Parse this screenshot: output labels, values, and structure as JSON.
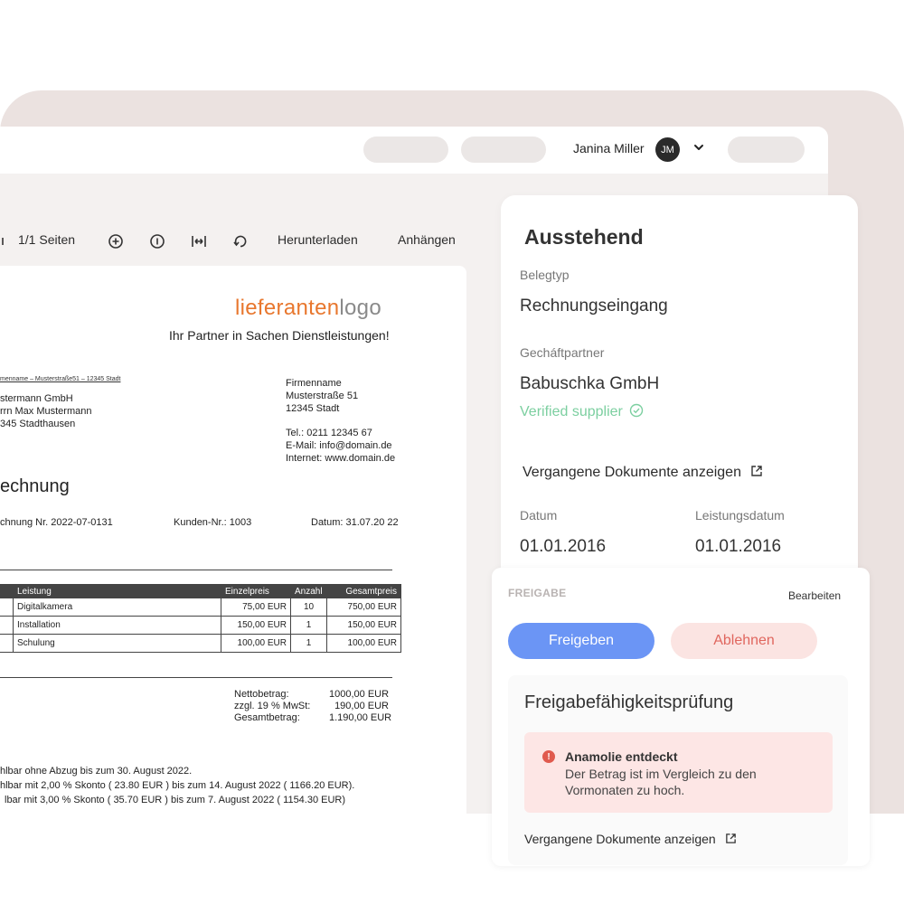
{
  "header": {
    "user_name": "Janina Miller",
    "user_initials": "JM"
  },
  "toolbar": {
    "pages": "1/1 Seiten",
    "download": "Herunterladen",
    "attach": "Anhängen",
    "icons": [
      "zoom-in-icon",
      "info-icon",
      "fit-width-icon",
      "rotate-icon"
    ]
  },
  "document": {
    "logo_part1": "lieferanten",
    "logo_part2": "logo",
    "logo_colors": {
      "part1": "#e8772e",
      "part2": "#8a8a8a"
    },
    "tagline": "Ihr Partner in Sachen Dienstleistungen!",
    "sender_line": "menname – Musterstraße51 – 12345 Stadt",
    "recipient": [
      "stermann GmbH",
      "rrn Max Mustermann",
      "345 Stadthausen"
    ],
    "company": [
      "Firmenname",
      "Musterstraße 51",
      "12345 Stadt"
    ],
    "contact": [
      "Tel.: 0211 12345 67",
      "E-Mail: info@domain.de",
      "Internet: www.domain.de"
    ],
    "title": "echnung",
    "invoice_no": "chnung Nr. 2022-07-0131",
    "customer_no": "Kunden-Nr.: 1003",
    "date": "Datum: 31.07.20 22",
    "table_headers": [
      "is",
      "Leistung",
      "Einzelpreis",
      "Anzahl",
      "Gesamtpreis"
    ],
    "table_rows": [
      [
        "",
        "Digitalkamera",
        "75,00 EUR",
        "10",
        "750,00 EUR"
      ],
      [
        "",
        "Installation",
        "150,00 EUR",
        "1",
        "150,00 EUR"
      ],
      [
        "",
        "Schulung",
        "100,00 EUR",
        "1",
        "100,00 EUR"
      ]
    ],
    "totals": [
      {
        "label": "Nettobetrag:",
        "value": "1000,00 EUR"
      },
      {
        "label": "zzgl. 19 % MwSt:",
        "value": "190,00 EUR"
      },
      {
        "label": "Gesamtbetrag:",
        "value": "1.190,00 EUR"
      }
    ],
    "terms": [
      "hlbar ohne Abzug bis zum 30. August 2022.",
      "hlbar mit 2,00 % Skonto ( 23.80 EUR ) bis zum 14. August 2022 ( 1166.20 EUR).",
      "lbar mit 3,00 % Skonto ( 35.70 EUR ) bis zum 7. August 2022 ( 1154.30 EUR)"
    ]
  },
  "details": {
    "status": "Ausstehend",
    "doc_type_label": "Belegtyp",
    "doc_type_value": "Rechnungseingang",
    "partner_label": "Gecháftpartner",
    "partner_value": "Babuschka GmbH",
    "verified": "Verified supplier",
    "past_docs": "Vergangene Dokumente anzeigen",
    "date_label": "Datum",
    "date_value": "01.01.2016",
    "service_date_label": "Leistungsdatum",
    "service_date_value": "01.01.2016"
  },
  "approval": {
    "section_label": "FREIGABE",
    "edit": "Bearbeiten",
    "approve": "Freigeben",
    "reject": "Ablehnen",
    "check_title": "Freigabefähigkeitsprüfung",
    "alert_title": "Anamolie entdeckt",
    "alert_text": "Der Betrag ist im Vergleich zu den Vormonaten zu hoch.",
    "past_docs": "Vergangene Dokumente anzeigen"
  },
  "colors": {
    "primary": "#6b95f5",
    "danger_bg": "#fbe4e2",
    "danger_text": "#e0665e",
    "verified": "#7ccfa0",
    "background": "#ebe2e0"
  }
}
